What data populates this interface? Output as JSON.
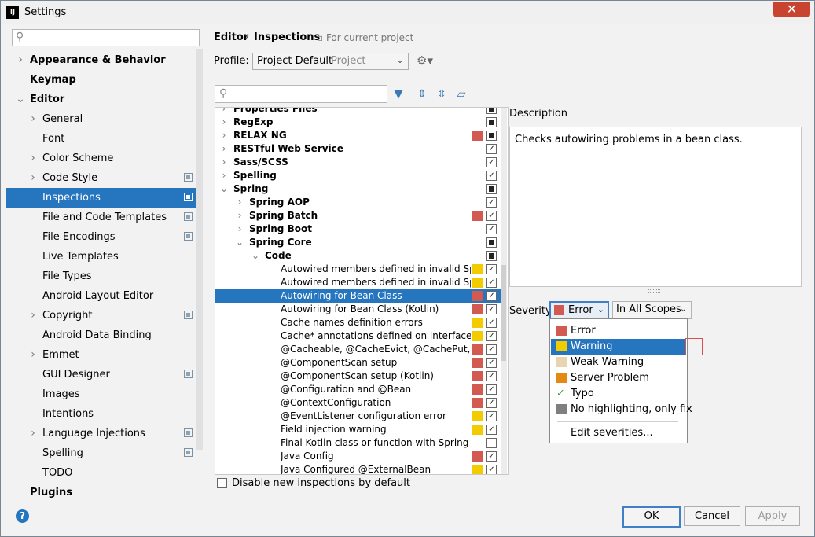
{
  "window": {
    "title": "Settings",
    "icon_text": "IJ",
    "close_symbol": "✕"
  },
  "sidebar": {
    "search_placeholder": "",
    "items": [
      {
        "label": "Appearance & Behavior",
        "level": 0,
        "expander": "›",
        "bold": true
      },
      {
        "label": "Keymap",
        "level": 0,
        "expander": "",
        "bold": true
      },
      {
        "label": "Editor",
        "level": 0,
        "expander": "⌄",
        "bold": true
      },
      {
        "label": "General",
        "level": 1,
        "expander": "›",
        "bold": false
      },
      {
        "label": "Font",
        "level": 1,
        "expander": "",
        "bold": false
      },
      {
        "label": "Color Scheme",
        "level": 1,
        "expander": "›",
        "bold": false
      },
      {
        "label": "Code Style",
        "level": 1,
        "expander": "›",
        "bold": false,
        "copy": true
      },
      {
        "label": "Inspections",
        "level": 1,
        "expander": "",
        "bold": false,
        "copy": true,
        "selected": true
      },
      {
        "label": "File and Code Templates",
        "level": 1,
        "expander": "",
        "bold": false,
        "copy": true
      },
      {
        "label": "File Encodings",
        "level": 1,
        "expander": "",
        "bold": false,
        "copy": true
      },
      {
        "label": "Live Templates",
        "level": 1,
        "expander": "",
        "bold": false
      },
      {
        "label": "File Types",
        "level": 1,
        "expander": "",
        "bold": false
      },
      {
        "label": "Android Layout Editor",
        "level": 1,
        "expander": "",
        "bold": false
      },
      {
        "label": "Copyright",
        "level": 1,
        "expander": "›",
        "bold": false,
        "copy": true
      },
      {
        "label": "Android Data Binding",
        "level": 1,
        "expander": "",
        "bold": false
      },
      {
        "label": "Emmet",
        "level": 1,
        "expander": "›",
        "bold": false
      },
      {
        "label": "GUI Designer",
        "level": 1,
        "expander": "",
        "bold": false,
        "copy": true
      },
      {
        "label": "Images",
        "level": 1,
        "expander": "",
        "bold": false
      },
      {
        "label": "Intentions",
        "level": 1,
        "expander": "",
        "bold": false
      },
      {
        "label": "Language Injections",
        "level": 1,
        "expander": "›",
        "bold": false,
        "copy": true
      },
      {
        "label": "Spelling",
        "level": 1,
        "expander": "",
        "bold": false,
        "copy": true
      },
      {
        "label": "TODO",
        "level": 1,
        "expander": "",
        "bold": false
      },
      {
        "label": "Plugins",
        "level": 0,
        "expander": "",
        "bold": true
      }
    ]
  },
  "header": {
    "breadcrumb_first": "Editor",
    "breadcrumb_sep": "›",
    "breadcrumb_last": "Inspections",
    "scope_note": "For current project",
    "profile_label": "Profile:",
    "profile_value": "Project Default",
    "profile_scope": "Project"
  },
  "colors": {
    "error": "#d35a50",
    "warning": "#f2cb00",
    "weak_warning": "#e8d5b0",
    "server_problem": "#e28a13",
    "no_highlighting": "#7f7f7f",
    "selection": "#2675bf"
  },
  "inspections": [
    {
      "label": "Properties Files",
      "level": 0,
      "expander": "›",
      "bold": true,
      "severity": "",
      "check": "partial"
    },
    {
      "label": "RegExp",
      "level": 0,
      "expander": "›",
      "bold": true,
      "severity": "",
      "check": "partial"
    },
    {
      "label": "RELAX NG",
      "level": 0,
      "expander": "›",
      "bold": true,
      "severity": "error",
      "check": "partial"
    },
    {
      "label": "RESTful Web Service",
      "level": 0,
      "expander": "›",
      "bold": true,
      "severity": "",
      "check": "checked"
    },
    {
      "label": "Sass/SCSS",
      "level": 0,
      "expander": "›",
      "bold": true,
      "severity": "",
      "check": "checked"
    },
    {
      "label": "Spelling",
      "level": 0,
      "expander": "›",
      "bold": true,
      "severity": "",
      "check": "checked"
    },
    {
      "label": "Spring",
      "level": 0,
      "expander": "⌄",
      "bold": true,
      "severity": "",
      "check": "partial"
    },
    {
      "label": "Spring AOP",
      "level": 1,
      "expander": "›",
      "bold": true,
      "severity": "",
      "check": "checked"
    },
    {
      "label": "Spring Batch",
      "level": 1,
      "expander": "›",
      "bold": true,
      "severity": "error",
      "check": "checked"
    },
    {
      "label": "Spring Boot",
      "level": 1,
      "expander": "›",
      "bold": true,
      "severity": "",
      "check": "checked"
    },
    {
      "label": "Spring Core",
      "level": 1,
      "expander": "⌄",
      "bold": true,
      "severity": "",
      "check": "partial"
    },
    {
      "label": "Code",
      "level": 2,
      "expander": "⌄",
      "bold": true,
      "severity": "",
      "check": "partial"
    },
    {
      "label": "Autowired members defined in invalid Sp",
      "level": 3,
      "expander": "",
      "bold": false,
      "severity": "warning",
      "check": "checked"
    },
    {
      "label": "Autowired members defined in invalid Sp",
      "level": 3,
      "expander": "",
      "bold": false,
      "severity": "warning",
      "check": "checked"
    },
    {
      "label": "Autowiring for Bean Class",
      "level": 3,
      "expander": "",
      "bold": false,
      "severity": "error",
      "check": "checked",
      "selected": true
    },
    {
      "label": "Autowiring for Bean Class (Kotlin)",
      "level": 3,
      "expander": "",
      "bold": false,
      "severity": "error",
      "check": "checked"
    },
    {
      "label": "Cache names definition errors",
      "level": 3,
      "expander": "",
      "bold": false,
      "severity": "warning",
      "check": "checked"
    },
    {
      "label": "Cache* annotations defined on interfaces",
      "level": 3,
      "expander": "",
      "bold": false,
      "severity": "warning",
      "check": "checked"
    },
    {
      "label": "@Cacheable, @CacheEvict, @CachePut, @",
      "level": 3,
      "expander": "",
      "bold": false,
      "severity": "error",
      "check": "checked"
    },
    {
      "label": "@ComponentScan setup",
      "level": 3,
      "expander": "",
      "bold": false,
      "severity": "error",
      "check": "checked"
    },
    {
      "label": "@ComponentScan setup (Kotlin)",
      "level": 3,
      "expander": "",
      "bold": false,
      "severity": "error",
      "check": "checked"
    },
    {
      "label": "@Configuration and @Bean",
      "level": 3,
      "expander": "",
      "bold": false,
      "severity": "error",
      "check": "checked"
    },
    {
      "label": "@ContextConfiguration",
      "level": 3,
      "expander": "",
      "bold": false,
      "severity": "error",
      "check": "checked"
    },
    {
      "label": "@EventListener configuration error",
      "level": 3,
      "expander": "",
      "bold": false,
      "severity": "warning",
      "check": "checked"
    },
    {
      "label": "Field injection warning",
      "level": 3,
      "expander": "",
      "bold": false,
      "severity": "warning",
      "check": "checked"
    },
    {
      "label": "Final Kotlin class or function with Spring a",
      "level": 3,
      "expander": "",
      "bold": false,
      "severity": "",
      "check": "unchecked"
    },
    {
      "label": "Java Config",
      "level": 3,
      "expander": "",
      "bold": false,
      "severity": "error",
      "check": "checked"
    },
    {
      "label": "Java Configured @ExternalBean",
      "level": 3,
      "expander": "",
      "bold": false,
      "severity": "warning",
      "check": "checked"
    }
  ],
  "description": {
    "label": "Description",
    "text": "Checks autowiring problems in a bean class."
  },
  "severity": {
    "label": "Severity:",
    "selected": "Error",
    "scope": "In All Scopes",
    "options": [
      {
        "label": "Error",
        "color": "#d35a50"
      },
      {
        "label": "Warning",
        "color": "#f2cb00",
        "selected": true
      },
      {
        "label": "Weak Warning",
        "color": "#e8d5b0"
      },
      {
        "label": "Server Problem",
        "color": "#e28a13"
      },
      {
        "label": "Typo",
        "icon": "checkmark-icon"
      },
      {
        "label": "No highlighting, only fix",
        "color": "#7f7f7f"
      }
    ],
    "edit": "Edit severities..."
  },
  "footer": {
    "disable_new": "Disable new inspections by default",
    "ok": "OK",
    "cancel": "Cancel",
    "apply": "Apply",
    "help": "?"
  }
}
